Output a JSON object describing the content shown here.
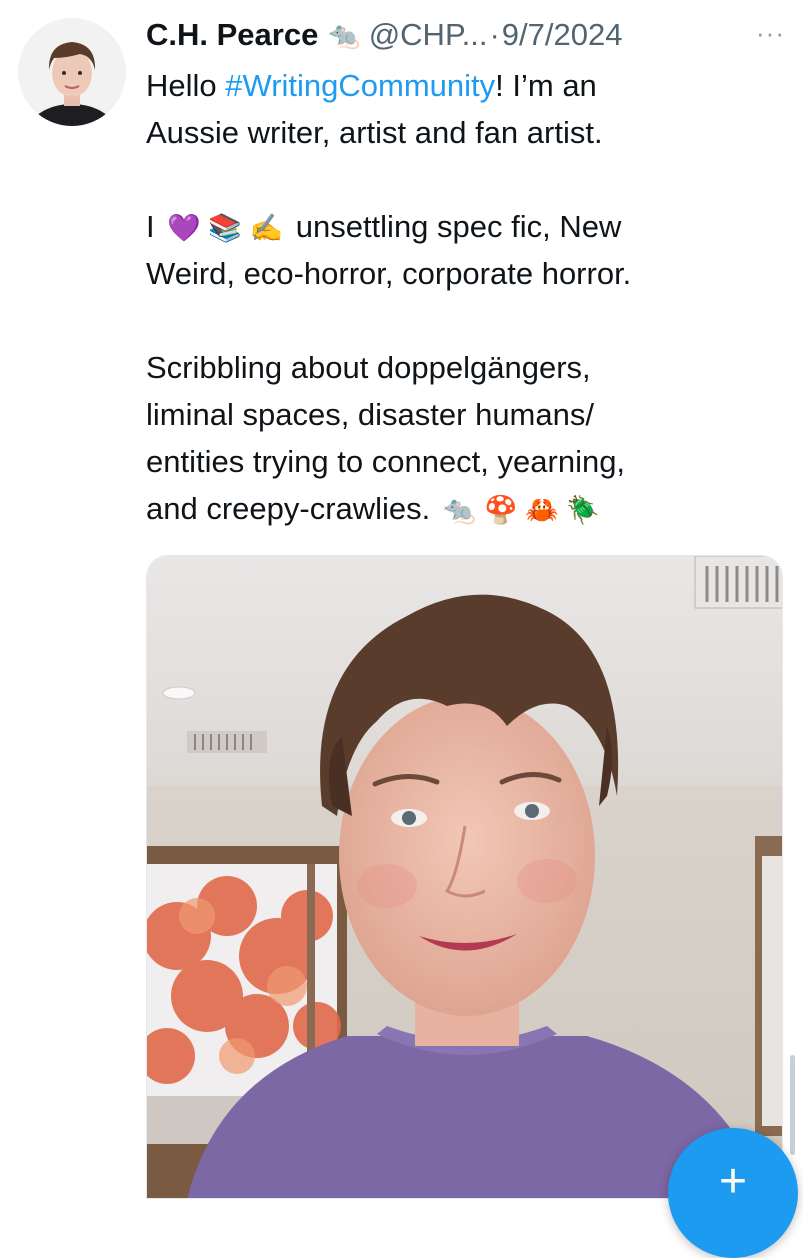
{
  "post": {
    "author_name": "C.H. Pearce",
    "name_emoji": "🐀",
    "handle": "@CHP...",
    "separator": "·",
    "date": "9/7/2024",
    "more_label": "···",
    "text": {
      "line1_pre": "Hello ",
      "hashtag": "#WritingCommunity",
      "line1_post": "! I’m an",
      "line2": "Aussie writer, artist and fan artist.",
      "line3_pre": "I",
      "line3_emojis": "💜 📚 ✍️",
      "line3_post": " unsettling spec fic, New",
      "line4": "Weird, eco-horror, corporate horror.",
      "line5": "Scribbling about doppelgängers,",
      "line6": "liminal spaces, disaster humans/",
      "line7": "entities trying to connect, yearning,",
      "line8": "and creepy-crawlies.",
      "line8_emojis": "🐀 🍄 🦀 🪲"
    }
  },
  "fab": {
    "label": "+"
  },
  "icons": {
    "avatar": "avatar-photo",
    "more": "more-options-icon",
    "compose": "compose-plus-icon"
  },
  "colors": {
    "link": "#1d9bf0",
    "secondary_text": "#536471",
    "primary_text": "#0f1419",
    "fab": "#1d9bf0"
  }
}
